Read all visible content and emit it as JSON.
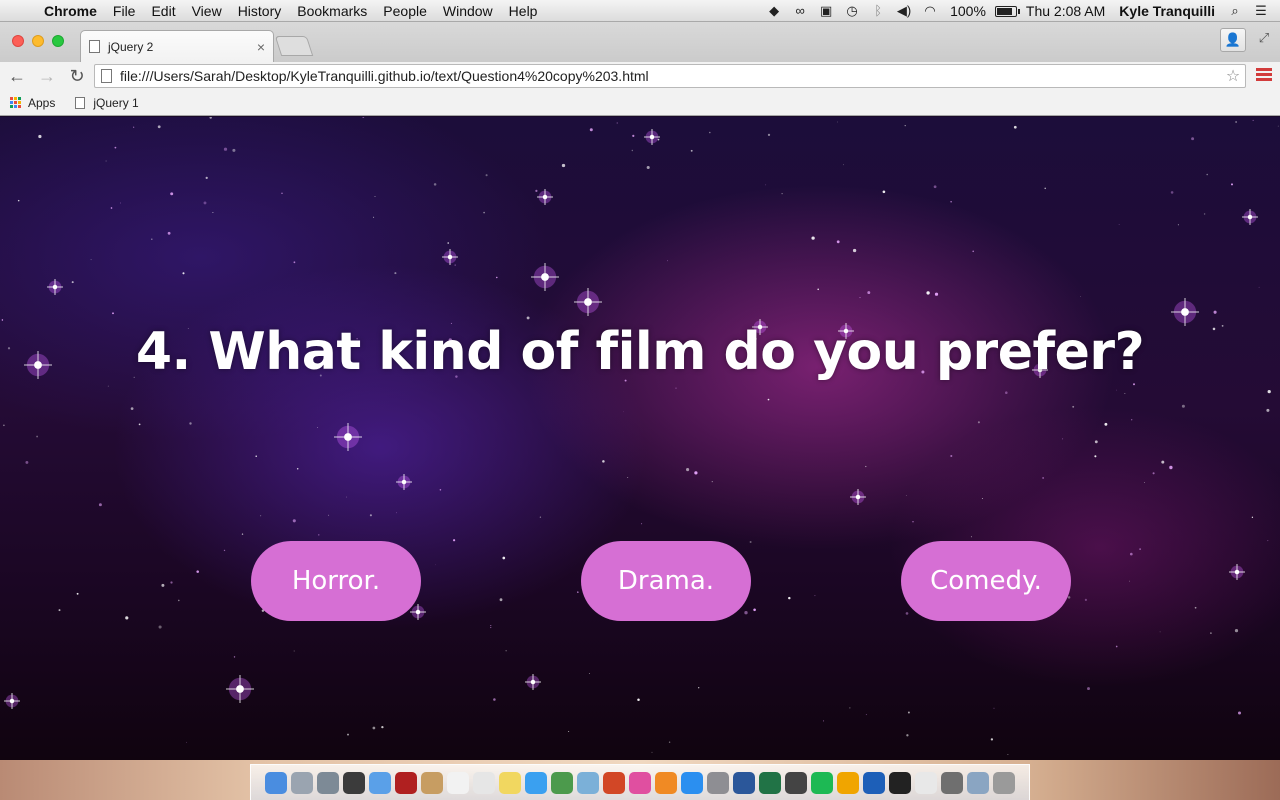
{
  "menubar": {
    "app_name": "Chrome",
    "items": [
      "File",
      "Edit",
      "View",
      "History",
      "Bookmarks",
      "People",
      "Window",
      "Help"
    ],
    "battery": "100%",
    "clock": "Thu 2:08 AM",
    "user": "Kyle Tranquilli"
  },
  "browser": {
    "tab_title": "jQuery 2",
    "url": "file:///Users/Sarah/Desktop/KyleTranquilli.github.io/text/Question4%20copy%203.html",
    "bookmarks": [
      "Apps",
      "jQuery 1"
    ]
  },
  "page": {
    "question": "4. What kind of film do you prefer?",
    "answers": [
      "Horror.",
      "Drama.",
      "Comedy."
    ],
    "button_color": "#d66fd4"
  },
  "dock": {
    "icons": [
      "finder-icon",
      "launchpad-icon",
      "help-icon",
      "activity-monitor-icon",
      "preview-icon",
      "photo-booth-icon",
      "contacts-icon",
      "calendar-icon",
      "textedit-icon",
      "stickies-icon",
      "messages-icon",
      "facetime-icon",
      "photos-icon",
      "powerpoint-icon",
      "itunes-icon",
      "ibooks-icon",
      "app-store-icon",
      "system-preferences-icon",
      "word-icon",
      "excel-icon",
      "terminal-icon",
      "spotify-icon",
      "outlook-icon",
      "adobe-icon",
      "github-icon",
      "chrome-icon",
      "documents-icon",
      "downloads-icon",
      "trash-icon"
    ]
  }
}
